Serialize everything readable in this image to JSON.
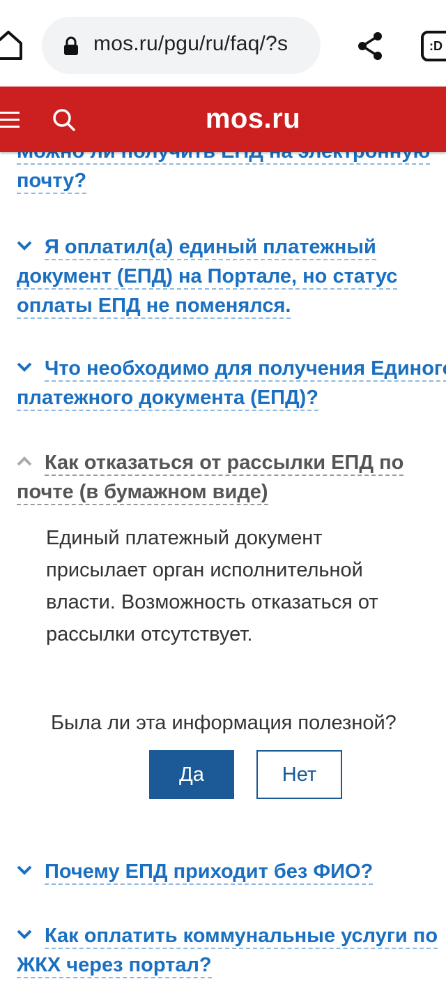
{
  "browser": {
    "url": "mos.ru/pgu/ru/faq/?s",
    "tabs_label": ":D"
  },
  "header": {
    "brand": "mos.ru"
  },
  "faq": {
    "q0": {
      "line1": "Можно ли получить ЕПД на электронную",
      "line2": "почту?"
    },
    "q1": {
      "line1": "Я оплатил(а) единый платежный",
      "line2": "документ (ЕПД) на Портале, но статус",
      "line3": "оплаты ЕПД не поменялся."
    },
    "q2": {
      "line1": "Что необходимо для получения Единого",
      "line2": "платежного документа (ЕПД)?"
    },
    "q3": {
      "line1": "Как отказаться от рассылки ЕПД по",
      "line2": "почте (в бумажном виде)"
    },
    "answer": {
      "line1": "Единый платежный документ",
      "line2": "присылает орган исполнительной",
      "line3": "власти. Возможность отказаться от",
      "line4": "рассылки отсутствует."
    },
    "q4": {
      "line1": "Почему ЕПД приходит без ФИО?"
    },
    "q5": {
      "line1": "Как оплатить коммунальные услуги по",
      "line2": "ЖКХ через портал?"
    }
  },
  "feedback": {
    "question": "Была ли эта информация полезной?",
    "yes_label": "Да",
    "no_label": "Нет"
  },
  "colors": {
    "header_red": "#cc1f1f",
    "link_blue": "#1a6fc0",
    "button_blue": "#1b5a96"
  }
}
